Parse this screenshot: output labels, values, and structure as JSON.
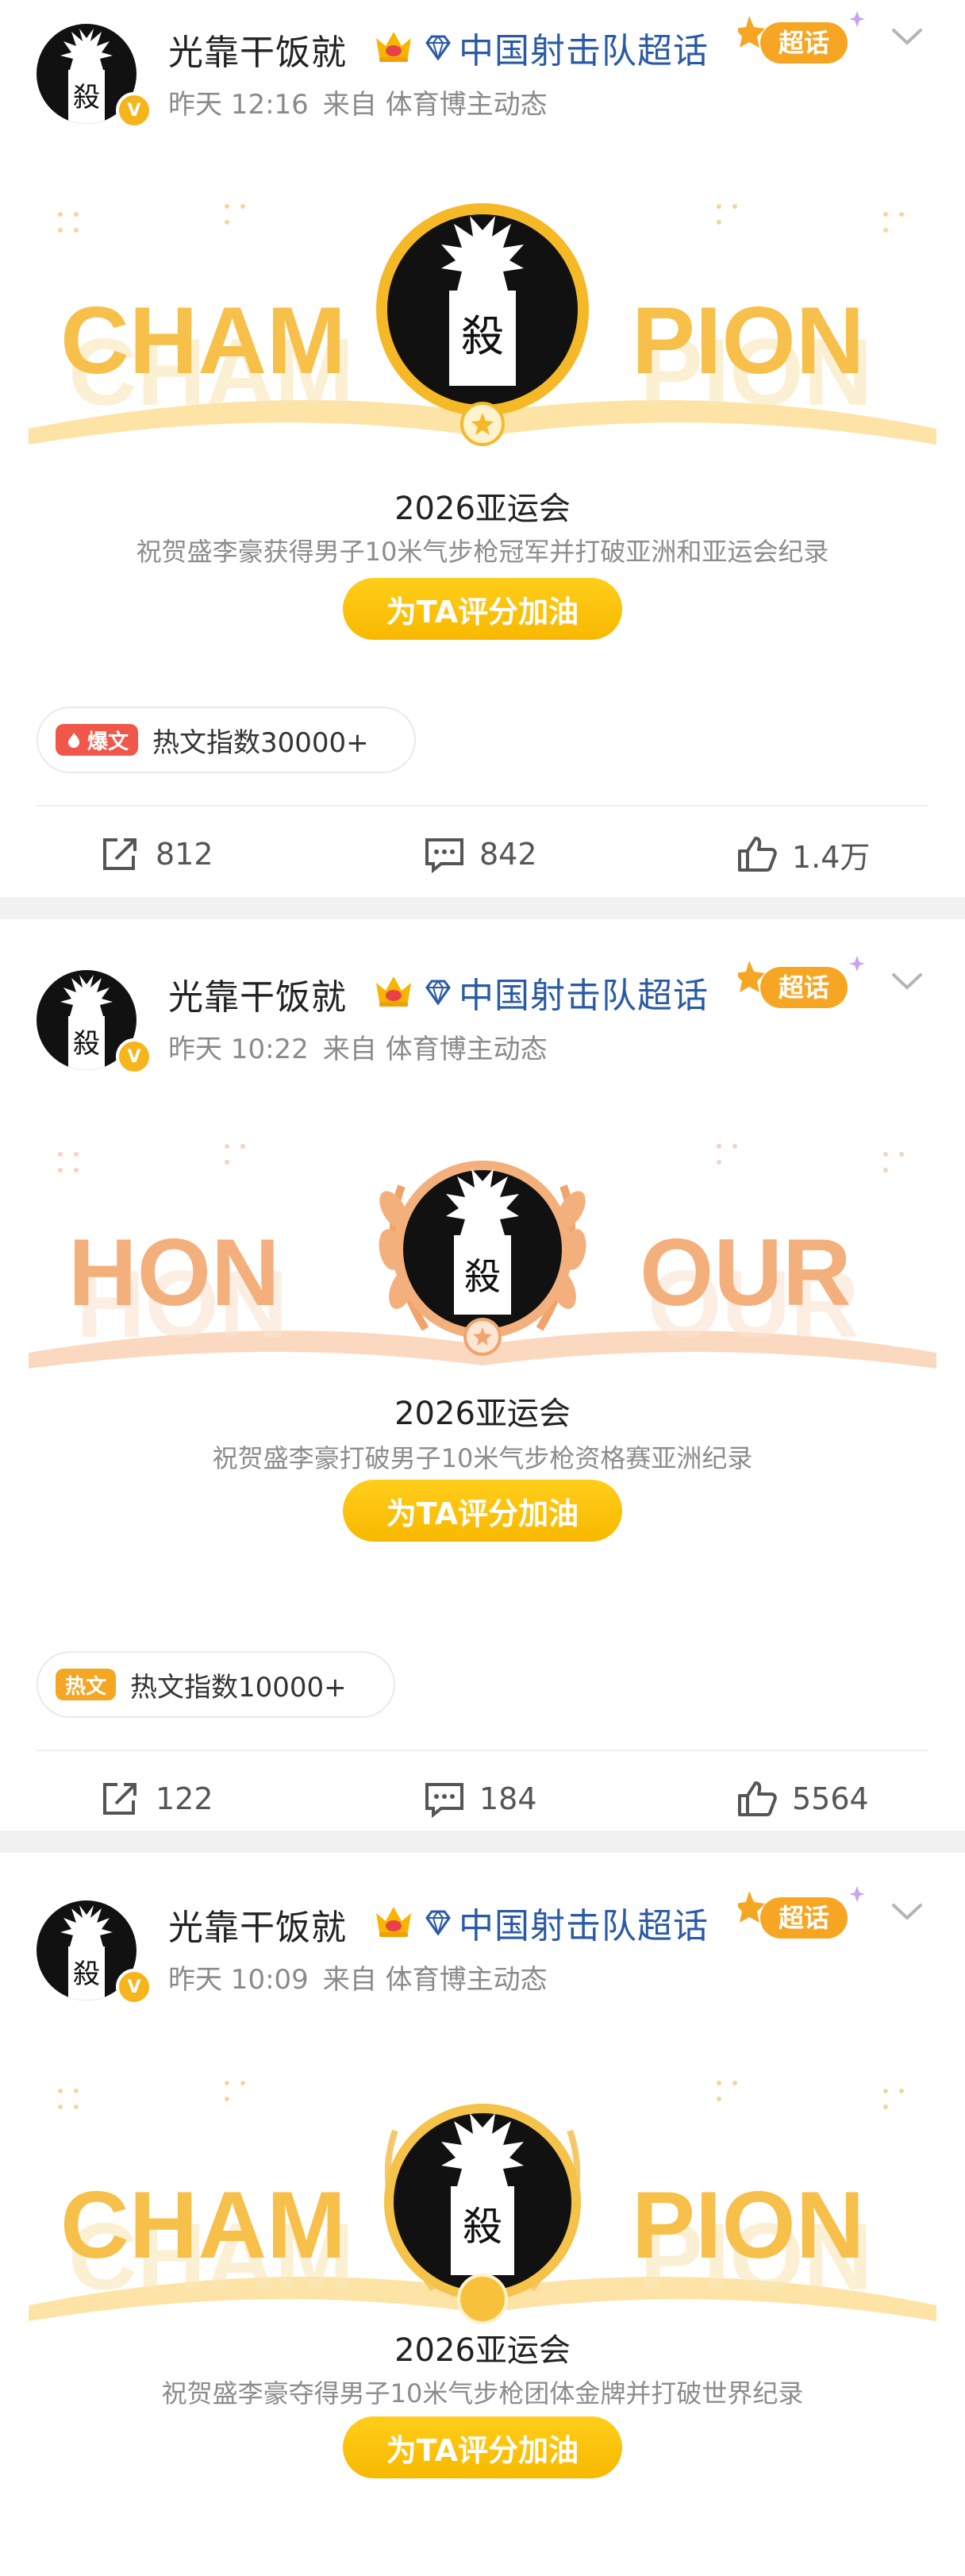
{
  "posts": [
    {
      "username": "光靠干饭就",
      "topic": "中国射击队超话",
      "chaohua_label": "超话",
      "time": "昨天 12:16",
      "source": "来自 体育博主动态",
      "banner_word_left": "CHAM",
      "banner_word_right": "PION",
      "event_title": "2026亚运会",
      "event_desc": "祝贺盛李豪获得男子10米气步枪冠军并打破亚洲和亚运会纪录",
      "cheer_label": "为TA评分加油",
      "hot_badge": "爆文",
      "hot_text": "热文指数30000+",
      "reposts": "812",
      "comments": "842",
      "likes": "1.4万"
    },
    {
      "username": "光靠干饭就",
      "topic": "中国射击队超话",
      "chaohua_label": "超话",
      "time": "昨天 10:22",
      "source": "来自 体育博主动态",
      "banner_word_left": "HON",
      "banner_word_right": "OUR",
      "event_title": "2026亚运会",
      "event_desc": "祝贺盛李豪打破男子10米气步枪资格赛亚洲纪录",
      "cheer_label": "为TA评分加油",
      "hot_badge": "热文",
      "hot_text": "热文指数10000+",
      "reposts": "122",
      "comments": "184",
      "likes": "5564"
    },
    {
      "username": "光靠干饭就",
      "topic": "中国射击队超话",
      "chaohua_label": "超话",
      "time": "昨天 10:09",
      "source": "来自 体育博主动态",
      "banner_word_left": "CHAM",
      "banner_word_right": "PION",
      "event_title": "2026亚运会",
      "event_desc": "祝贺盛李豪夺得男子10米气步枪团体金牌并打破世界纪录",
      "cheer_label": "为TA评分加油"
    }
  ],
  "icons": {
    "avatar_glyph": "殺",
    "verified": "V"
  },
  "colors": {
    "topic_link": "#2a5aa6",
    "cheer_button": "#f8b800",
    "champion_gold": "#f7c04a",
    "honour_orange": "#f3b07c",
    "hot_badge_red": "#f0574a",
    "hot_badge_orange": "#f5a623"
  }
}
